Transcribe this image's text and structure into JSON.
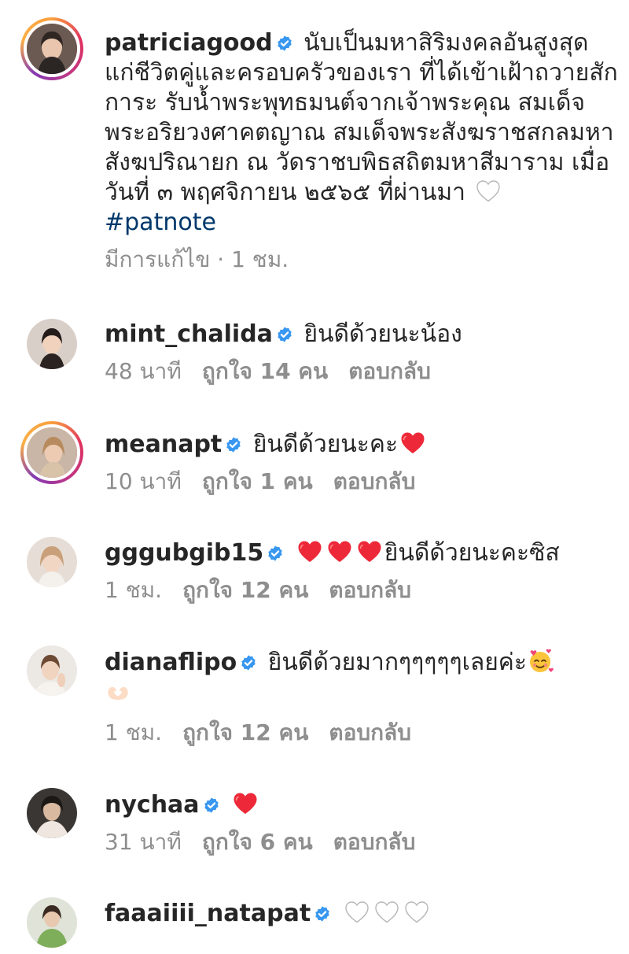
{
  "caption": {
    "username": "patriciagood",
    "text": "นับเป็นมหาสิริมงคลอันสูงสุด แก่ชีวิตคู่และครอบครัวของเรา ที่ได้เข้าเฝ้าถวายสักการะ รับน้ำพระพุทธมนต์จากเจ้าพระคุณ สมเด็จพระอริยวงศาคตญาณ สมเด็จพระสังฆราชสกลมหาสังฆปริณายก ณ วัดราชบพิธสถิตมหาสีมาราม เมื่อวันที่ ๓ พฤศจิกายน ๒๕๖๕ ที่ผ่านมา",
    "hashtag": "#patnote",
    "meta": "มีการแก้ไข · 1 ชม."
  },
  "comments": [
    {
      "username": "mint_chalida",
      "text": "ยินดีด้วยนะน้อง",
      "time": "48 นาที",
      "likes": "ถูกใจ 14 คน",
      "reply": "ตอบกลับ"
    },
    {
      "username": "meanapt",
      "text": "ยินดีด้วยนะคะ",
      "time": "10 นาที",
      "likes": "ถูกใจ 1 คน",
      "reply": "ตอบกลับ"
    },
    {
      "username": "gggubgib15",
      "text": "ยินดีด้วยนะคะซิส",
      "time": "1 ชม.",
      "likes": "ถูกใจ 12 คน",
      "reply": "ตอบกลับ"
    },
    {
      "username": "dianaflipo",
      "text": "ยินดีด้วยมากๆๆๆๆๆเลยค่ะ",
      "time": "1 ชม.",
      "likes": "ถูกใจ 12 คน",
      "reply": "ตอบกลับ"
    },
    {
      "username": "nychaa",
      "text": "",
      "time": "31 นาที",
      "likes": "ถูกใจ 6 คน",
      "reply": "ตอบกลับ"
    },
    {
      "username": "faaaiiii_natapat",
      "text": ""
    }
  ],
  "icons": {
    "verified": "verified-badge-icon",
    "red_heart": "red-heart-emoji",
    "white_heart": "white-heart-emoji",
    "smiling_hearts": "smiling-face-with-hearts-emoji",
    "heart_hands": "heart-hands-emoji"
  },
  "colors": {
    "verified": "#3897f0",
    "hashtag": "#00376b",
    "meta": "#8e8e8e",
    "heart": "#ed2939"
  }
}
